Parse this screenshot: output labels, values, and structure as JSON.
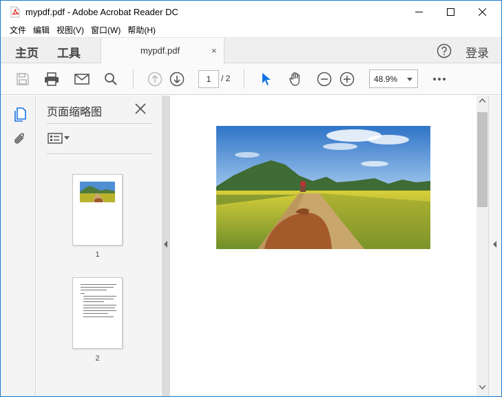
{
  "window": {
    "title": "mypdf.pdf - Adobe Acrobat Reader DC",
    "accent_color": "#1979ca"
  },
  "menu": {
    "items": [
      "文件",
      "编辑",
      "视图(V)",
      "窗口(W)",
      "帮助(H)"
    ]
  },
  "tabs": {
    "home": "主页",
    "tools": "工具",
    "document": "mypdf.pdf",
    "close": "×",
    "login": "登录"
  },
  "toolbar": {
    "icons": [
      "save-icon",
      "print-icon",
      "mail-icon",
      "search-icon",
      "page-up-icon",
      "page-down-icon",
      "select-icon",
      "hand-icon",
      "zoom-out-icon",
      "zoom-in-icon",
      "more-icon"
    ],
    "page_current": "1",
    "page_total": "/ 2",
    "zoom": "48.9%"
  },
  "panel": {
    "title": "页面缩略图",
    "thumbnails": [
      {
        "label": "1"
      },
      {
        "label": "2"
      }
    ]
  },
  "colors": {
    "select_tool": "#1473e6",
    "chrome_bg": "#efefef"
  }
}
